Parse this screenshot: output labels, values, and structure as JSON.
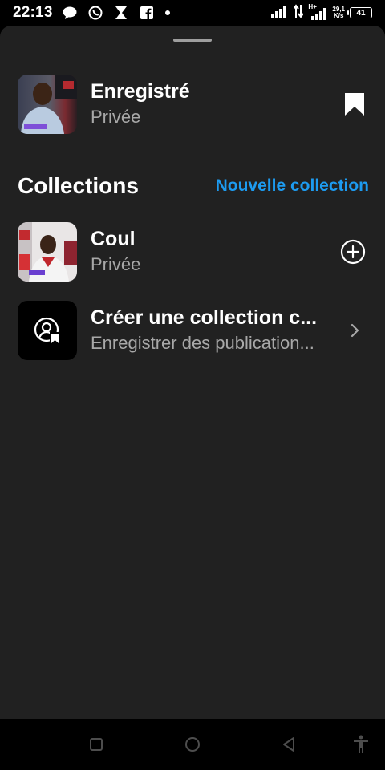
{
  "status_bar": {
    "time": "22:13",
    "network_speed_value": "29,1",
    "network_speed_unit": "K/s",
    "network_type": "H+",
    "battery": "41",
    "notification_icons": [
      "message-bubble-icon",
      "whatsapp-icon",
      "hourglass-icon",
      "facebook-icon",
      "dot-icon"
    ]
  },
  "saved": {
    "title": "Enregistré",
    "subtitle": "Privée"
  },
  "collections_header": {
    "title": "Collections",
    "new_collection_label": "Nouvelle collection"
  },
  "collections": [
    {
      "title": "Coul",
      "subtitle": "Privée",
      "action_icon": "add-circle-icon"
    },
    {
      "title": "Créer une collection c...",
      "subtitle": "Enregistrer des publication...",
      "action_icon": "chevron-right-icon"
    }
  ],
  "colors": {
    "accent": "#1d9bf0",
    "sheet_background": "#212121",
    "secondary_text": "#a8a8a8"
  }
}
